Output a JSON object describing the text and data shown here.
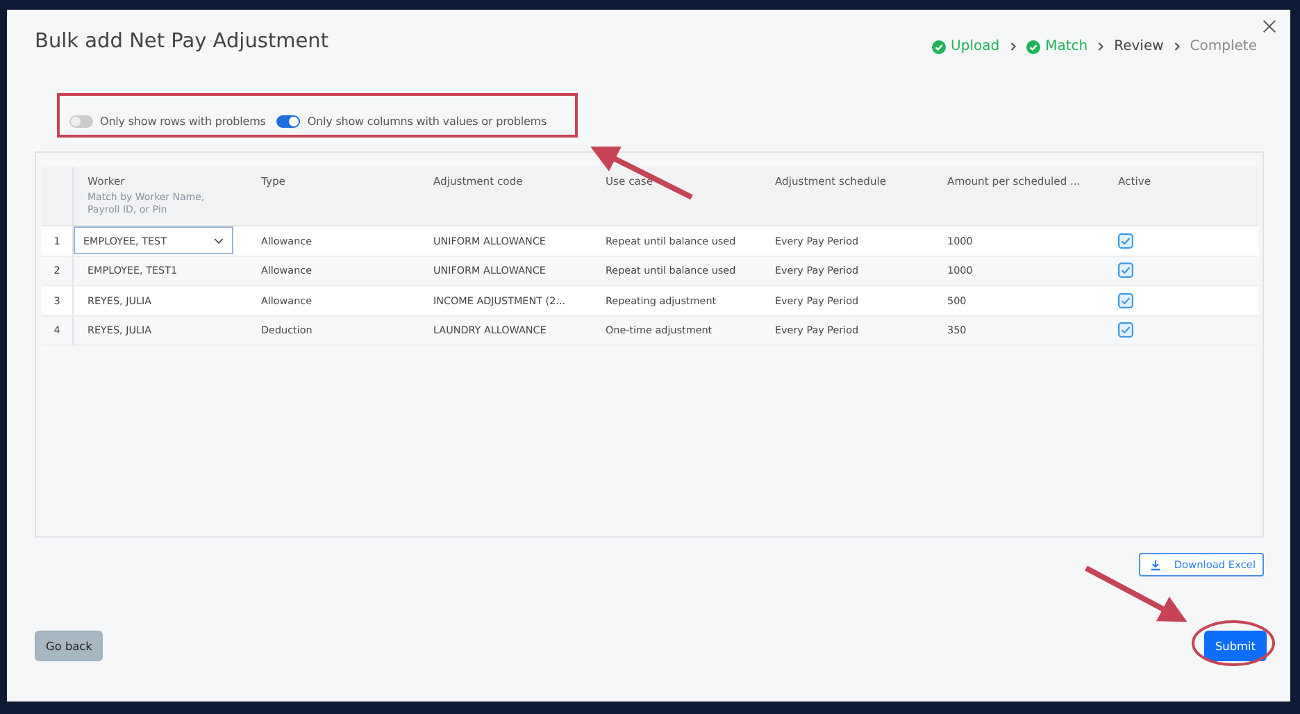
{
  "dialog": {
    "title": "Bulk add Net Pay Adjustment"
  },
  "steps": [
    {
      "label": "Upload",
      "done": true,
      "selected": false
    },
    {
      "label": "Match",
      "done": true,
      "selected": false
    },
    {
      "label": "Review",
      "done": false,
      "selected": true
    },
    {
      "label": "Complete",
      "done": false,
      "selected": false
    }
  ],
  "toggles": [
    {
      "label": "Only show rows with problems",
      "on": false
    },
    {
      "label": "Only show columns with values or problems",
      "on": true
    }
  ],
  "table": {
    "columns": [
      {
        "label": "Worker",
        "hint": "Match by Worker Name, Payroll ID, or Pin"
      },
      {
        "label": "Type"
      },
      {
        "label": "Adjustment code"
      },
      {
        "label": "Use case"
      },
      {
        "label": "Adjustment schedule"
      },
      {
        "label": "Amount per scheduled ..."
      },
      {
        "label": "Active"
      }
    ],
    "rows": [
      {
        "index": "1",
        "worker": "EMPLOYEE, TEST",
        "selected": true,
        "type": "Allowance",
        "code": "UNIFORM ALLOWANCE",
        "use_case": "Repeat until balance used",
        "schedule": "Every Pay Period",
        "amount": "1000",
        "active": true
      },
      {
        "index": "2",
        "worker": "EMPLOYEE, TEST1",
        "selected": false,
        "type": "Allowance",
        "code": "UNIFORM ALLOWANCE",
        "use_case": "Repeat until balance used",
        "schedule": "Every Pay Period",
        "amount": "1000",
        "active": true
      },
      {
        "index": "3",
        "worker": "REYES, JULIA",
        "selected": false,
        "type": "Allowance",
        "code": "INCOME ADJUSTMENT (2...",
        "use_case": "Repeating adjustment",
        "schedule": "Every Pay Period",
        "amount": "500",
        "active": true
      },
      {
        "index": "4",
        "worker": "REYES, JULIA",
        "selected": false,
        "type": "Deduction",
        "code": "LAUNDRY ALLOWANCE",
        "use_case": "One-time adjustment",
        "schedule": "Every Pay Period",
        "amount": "350",
        "active": true
      }
    ]
  },
  "download_button": "Download Excel",
  "back_button": "Go back",
  "submit_button": "Submit"
}
